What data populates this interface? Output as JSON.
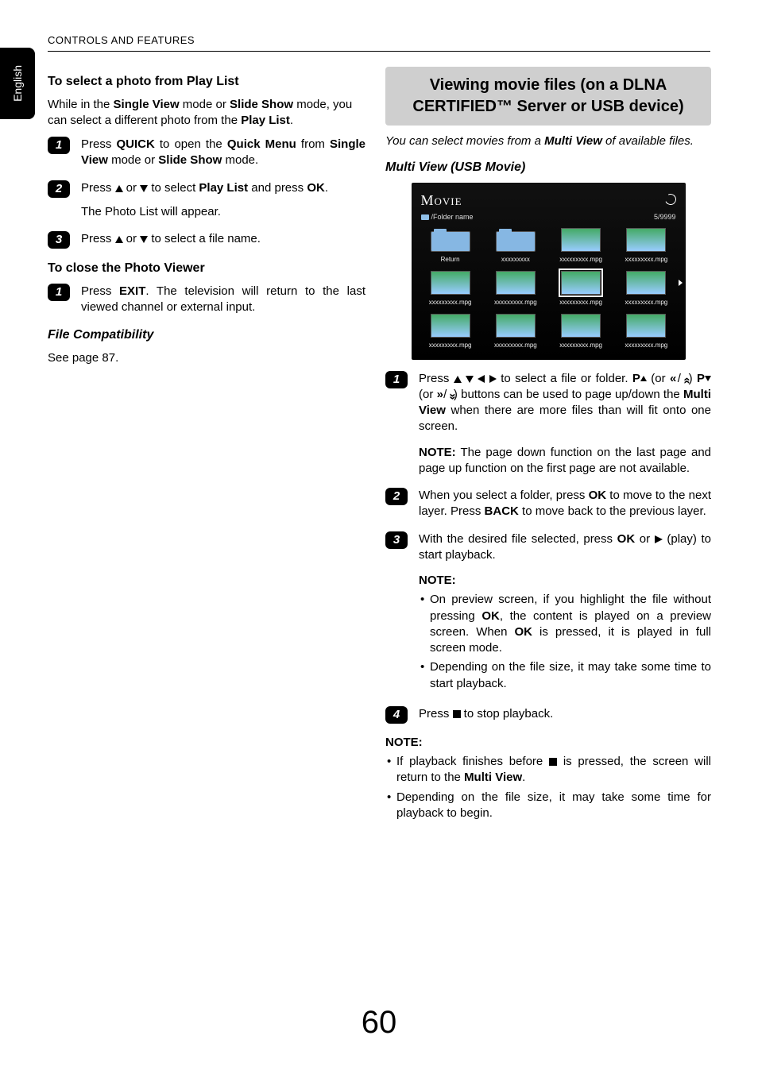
{
  "header": "CONTROLS AND FEATURES",
  "langTab": "English",
  "pageNumber": "60",
  "left": {
    "title1": "To select a photo from Play List",
    "intro_a": "While in the ",
    "intro_b1": "Single View",
    "intro_c": " mode or ",
    "intro_b2": "Slide Show",
    "intro_d": " mode, you can select a different photo from the ",
    "intro_b3": "Play List",
    "intro_e": ".",
    "s1_a": "Press ",
    "s1_b1": "QUICK",
    "s1_c": " to open the ",
    "s1_b2": "Quick Menu",
    "s1_d": " from ",
    "s1_b3": "Single View",
    "s1_e": " mode or ",
    "s1_b4": "Slide Show",
    "s1_f": " mode.",
    "s2_a": "Press ",
    "s2_b": " or ",
    "s2_c": " to select ",
    "s2_d": "Play List",
    "s2_e": " and press ",
    "s2_f": "OK",
    "s2_g": ".",
    "s2_sub": "The Photo List will appear.",
    "s3_a": "Press ",
    "s3_b": " or ",
    "s3_c": " to select a file name.",
    "title2": "To close the Photo Viewer",
    "close_a": "Press ",
    "close_b": "EXIT",
    "close_c": ". The television will return to the last viewed channel or external input.",
    "title3": "File Compatibility",
    "compat": "See page 87."
  },
  "right": {
    "featureTitle": "Viewing movie files (on a DLNA CERTIFIED™ Server or USB device)",
    "featureSub_a": "You can select movies from a ",
    "featureSub_b": "Multi View",
    "featureSub_c": " of available files.",
    "mvTitle": "Multi View (USB Movie)",
    "screen": {
      "title": "Movie",
      "path": "/Folder name",
      "counter": "5/9999",
      "returnLabel": "Return",
      "folderLabel": "xxxxxxxxx",
      "fileLabel": "xxxxxxxxx.mpg"
    },
    "r1_a": "Press ",
    "r1_b": " to select a file or folder. ",
    "r1_c1": "P",
    "r1_c2": " (or ",
    "r1_c3": " / ",
    "r1_c4": ") ",
    "r1_d1": "P",
    "r1_d2": " (or ",
    "r1_d3": " / ",
    "r1_d4": ") buttons can be used to page up/down the ",
    "r1_e": "Multi View",
    "r1_f": " when there are more files than will fit onto one screen.",
    "r1_note_a": "NOTE:",
    "r1_note_b": " The page down function on the last page and page up function on the first page are not available.",
    "r2_a": "When you select a folder, press ",
    "r2_b": "OK",
    "r2_c": " to move to the next layer. Press ",
    "r2_d": "BACK",
    "r2_e": " to move back to the previous layer.",
    "r3_a": "With the desired file selected, press ",
    "r3_b": "OK",
    "r3_c": " or ",
    "r3_d": " (play) to start playback.",
    "r3_noteTitle": "NOTE:",
    "r3_li1_a": "On preview screen, if you highlight the file without pressing ",
    "r3_li1_b": "OK",
    "r3_li1_c": ", the content is played on a preview screen. When ",
    "r3_li1_d": "OK",
    "r3_li1_e": " is pressed, it is played in full screen mode.",
    "r3_li2": "Depending on the file size, it may take some time to start playback.",
    "r4_a": "Press ",
    "r4_b": " to stop playback.",
    "endNoteTitle": "NOTE:",
    "end_li1_a": "If playback finishes before ",
    "end_li1_b": " is pressed, the screen will return to the ",
    "end_li1_c": "Multi View",
    "end_li1_d": ".",
    "end_li2": "Depending on the file size, it may take some time for playback to begin."
  }
}
